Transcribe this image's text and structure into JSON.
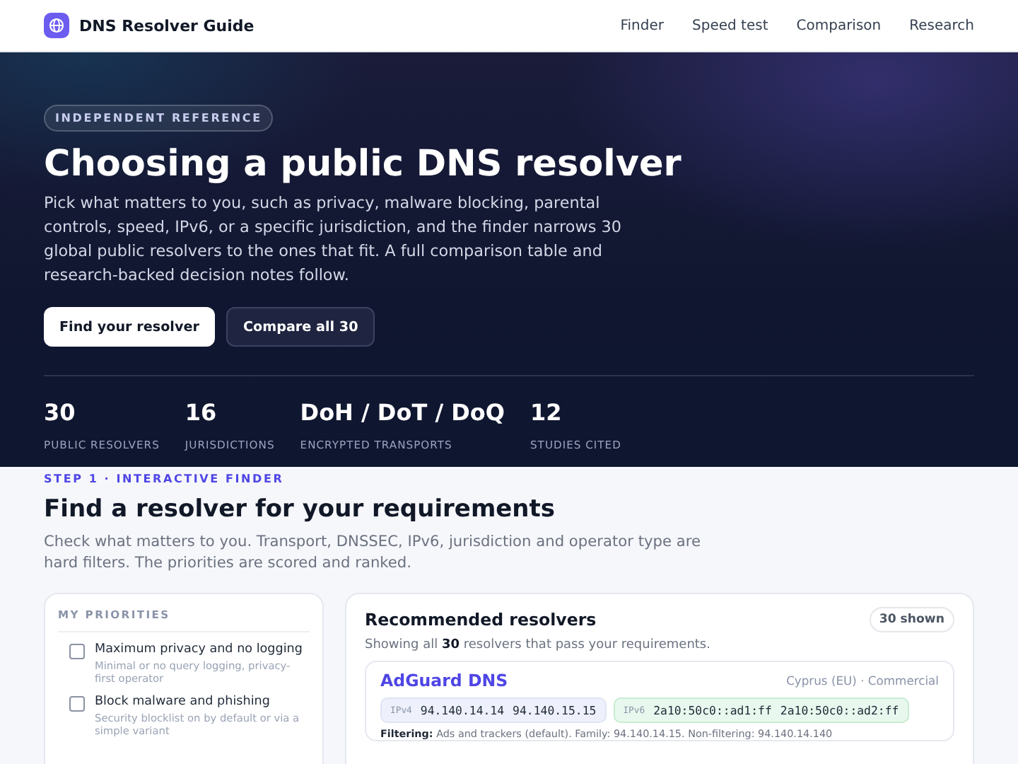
{
  "header": {
    "brand": "DNS Resolver Guide",
    "nav": [
      "Finder",
      "Speed test",
      "Comparison",
      "Research"
    ]
  },
  "hero": {
    "badge": "INDEPENDENT REFERENCE",
    "title": "Choosing a public DNS resolver",
    "intro": "Pick what matters to you, such as privacy, malware blocking, parental controls, speed, IPv6, or a specific jurisdiction, and the finder narrows 30 global public resolvers to the ones that fit. A full comparison table and research-backed decision notes follow.",
    "buttons": [
      {
        "label": "Find your resolver",
        "kind": "primary"
      },
      {
        "label": "Compare all 30",
        "kind": "secondary"
      }
    ],
    "stats": [
      {
        "value": "30",
        "label": "PUBLIC RESOLVERS"
      },
      {
        "value": "16",
        "label": "JURISDICTIONS"
      },
      {
        "value": "DoH / DoT / DoQ",
        "label": "ENCRYPTED TRANSPORTS"
      },
      {
        "value": "12",
        "label": "STUDIES CITED"
      }
    ]
  },
  "finder": {
    "step": "STEP 1 · INTERACTIVE FINDER",
    "title": "Find a resolver for your requirements",
    "description": "Check what matters to you. Transport, DNSSEC, IPv6, jurisdiction and operator type are hard filters. The priorities are scored and ranked.",
    "priorities": {
      "title": "MY PRIORITIES",
      "items": [
        {
          "label": "Maximum privacy and no logging",
          "hint": "Minimal or no query logging, privacy-first operator",
          "checked": false
        },
        {
          "label": "Block malware and phishing",
          "hint": "Security blocklist on by default or via a simple variant",
          "checked": false
        }
      ]
    },
    "results": {
      "title": "Recommended resolvers",
      "count": "30 shown",
      "summary": "Showing all **30** resolvers that pass your requirements.",
      "resolvers": [
        {
          "name": "AdGuard DNS",
          "meta": "Cyprus (EU) · Commercial",
          "addresses": [
            {
              "kind": "ipv4",
              "label": "IPv4",
              "values": [
                "94.140.14.14",
                "94.140.15.15"
              ]
            },
            {
              "kind": "ipv6",
              "label": "IPv6",
              "values": [
                "2a10:50c0::ad1:ff",
                "2a10:50c0::ad2:ff"
              ]
            }
          ],
          "filtering": "**Filtering:** Ads and trackers (default). Family: 94.140.14.15. Non-filtering: 94.140.14.140"
        }
      ]
    }
  }
}
